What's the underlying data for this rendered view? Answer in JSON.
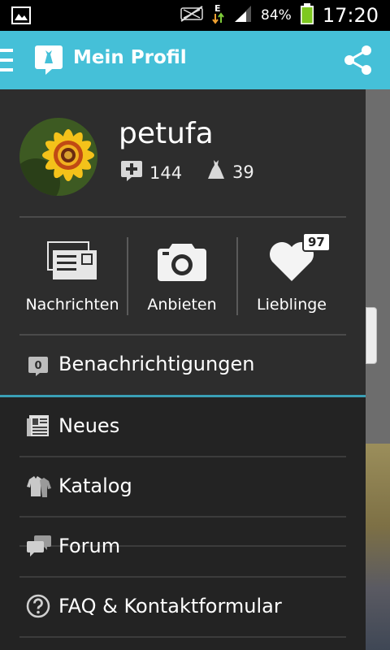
{
  "status_bar": {
    "battery_percent": "84%",
    "time": "17:20",
    "icons": [
      "image-icon",
      "no-sound-icon",
      "data-e-icon",
      "signal-icon",
      "battery-icon"
    ]
  },
  "app_bar": {
    "title": "Mein Profil",
    "icons": [
      "hamburger-menu-icon",
      "app-logo-icon",
      "share-icon"
    ],
    "color": "#45c0d8"
  },
  "profile": {
    "username": "petufa",
    "stats": [
      {
        "icon": "plus-speech-icon",
        "value": "144"
      },
      {
        "icon": "dress-icon",
        "value": "39"
      }
    ]
  },
  "quick_actions": [
    {
      "label": "Nachrichten",
      "icon": "messages-icon"
    },
    {
      "label": "Anbieten",
      "icon": "camera-icon"
    },
    {
      "label": "Lieblinge",
      "icon": "heart-icon",
      "badge": "97"
    }
  ],
  "notifications": {
    "label": "Benachrichtigungen",
    "count": "0"
  },
  "menu": [
    {
      "label": "Neues",
      "icon": "newspaper-icon"
    },
    {
      "label": "Katalog",
      "icon": "clothes-icon"
    },
    {
      "label": "Forum",
      "icon": "chat-bubbles-icon"
    },
    {
      "label": "FAQ & Kontaktformular",
      "icon": "help-circle-icon"
    }
  ]
}
